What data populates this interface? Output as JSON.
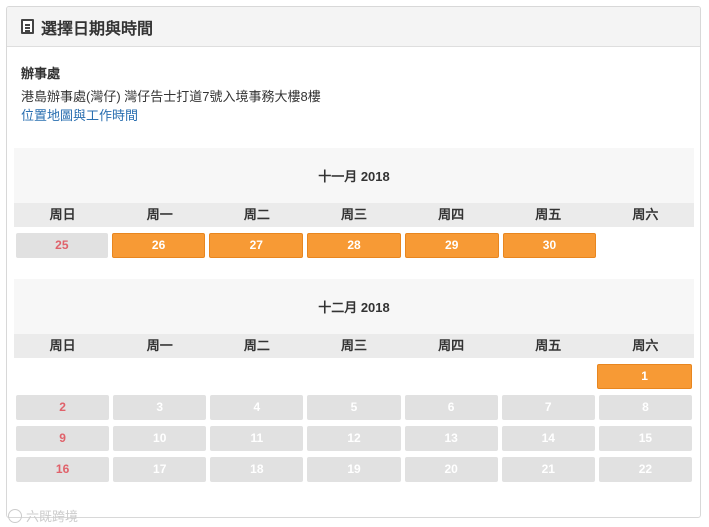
{
  "panel": {
    "title": "選擇日期與時間",
    "icon": "document-list-icon"
  },
  "office": {
    "label": "辦事處",
    "address": "港島辦事處(灣仔) 灣仔告士打道7號入境事務大樓8樓",
    "link": "位置地圖與工作時間"
  },
  "weekdays": [
    "周日",
    "周一",
    "周二",
    "周三",
    "周四",
    "周五",
    "周六"
  ],
  "months": [
    {
      "title": "十一月 2018",
      "weeks": [
        [
          {
            "day": "25",
            "state": "unavailable"
          },
          {
            "day": "26",
            "state": "available"
          },
          {
            "day": "27",
            "state": "available"
          },
          {
            "day": "28",
            "state": "available"
          },
          {
            "day": "29",
            "state": "available"
          },
          {
            "day": "30",
            "state": "available"
          },
          {
            "day": "",
            "state": "empty"
          }
        ]
      ]
    },
    {
      "title": "十二月 2018",
      "weeks": [
        [
          {
            "day": "",
            "state": "empty"
          },
          {
            "day": "",
            "state": "empty"
          },
          {
            "day": "",
            "state": "empty"
          },
          {
            "day": "",
            "state": "empty"
          },
          {
            "day": "",
            "state": "empty"
          },
          {
            "day": "",
            "state": "empty"
          },
          {
            "day": "1",
            "state": "available"
          }
        ],
        [
          {
            "day": "2",
            "state": "unavailable"
          },
          {
            "day": "3",
            "state": "unavailable"
          },
          {
            "day": "4",
            "state": "unavailable"
          },
          {
            "day": "5",
            "state": "unavailable"
          },
          {
            "day": "6",
            "state": "unavailable"
          },
          {
            "day": "7",
            "state": "unavailable"
          },
          {
            "day": "8",
            "state": "unavailable"
          }
        ],
        [
          {
            "day": "9",
            "state": "unavailable"
          },
          {
            "day": "10",
            "state": "unavailable"
          },
          {
            "day": "11",
            "state": "unavailable"
          },
          {
            "day": "12",
            "state": "unavailable"
          },
          {
            "day": "13",
            "state": "unavailable"
          },
          {
            "day": "14",
            "state": "unavailable"
          },
          {
            "day": "15",
            "state": "unavailable"
          }
        ],
        [
          {
            "day": "16",
            "state": "unavailable"
          },
          {
            "day": "17",
            "state": "unavailable"
          },
          {
            "day": "18",
            "state": "unavailable"
          },
          {
            "day": "19",
            "state": "unavailable"
          },
          {
            "day": "20",
            "state": "unavailable"
          },
          {
            "day": "21",
            "state": "unavailable"
          },
          {
            "day": "22",
            "state": "unavailable"
          }
        ]
      ]
    }
  ],
  "watermark": "六既跨境",
  "colors": {
    "available": "#f79a35",
    "unavailable": "#e1e1e1",
    "sunday_text": "#e0616a",
    "link": "#2a6fb0"
  }
}
